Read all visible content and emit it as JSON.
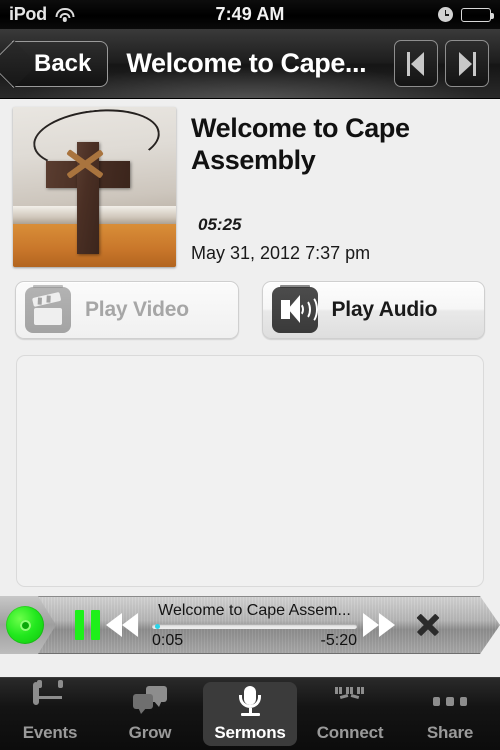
{
  "status_bar": {
    "carrier": "iPod",
    "wifi_icon": "wifi-icon",
    "time": "7:49 AM",
    "alarm_icon": "clock-icon",
    "battery_icon": "battery-icon",
    "battery_level_pct": 88
  },
  "nav_bar": {
    "back_label": "Back",
    "title": "Welcome to Cape...",
    "prev_icon": "previous-track-icon",
    "next_icon": "next-track-icon"
  },
  "sermon": {
    "thumbnail_alt": "wooden-cross-on-bible",
    "title": "Welcome to Cape Assembly",
    "duration": "05:25",
    "date": "May 31, 2012 7:37 pm"
  },
  "actions": {
    "play_video_label": "Play Video",
    "play_video_icon": "clapperboard-icon",
    "play_video_enabled": false,
    "play_audio_label": "Play Audio",
    "play_audio_icon": "speaker-icon",
    "play_audio_enabled": true
  },
  "notes_panel": {
    "content": ""
  },
  "player": {
    "disc_icon": "disc-icon",
    "pause_icon": "pause-icon",
    "rewind_icon": "rewind-icon",
    "forward_icon": "fast-forward-icon",
    "close_icon": "close-icon",
    "track_title": "Welcome to Cape Assem...",
    "elapsed": "0:05",
    "remaining": "-5:20",
    "progress_pct": 1.5,
    "accent_color": "#1ef01a",
    "knob_color": "#2ad4e8"
  },
  "tab_bar": {
    "items": [
      {
        "label": "Events",
        "icon": "calendar-icon",
        "active": false
      },
      {
        "label": "Grow",
        "icon": "chat-bubbles-icon",
        "active": false
      },
      {
        "label": "Sermons",
        "icon": "microphone-icon",
        "active": true
      },
      {
        "label": "Connect",
        "icon": "people-icon",
        "active": false
      },
      {
        "label": "Share",
        "icon": "more-dots-icon",
        "active": false
      }
    ]
  }
}
